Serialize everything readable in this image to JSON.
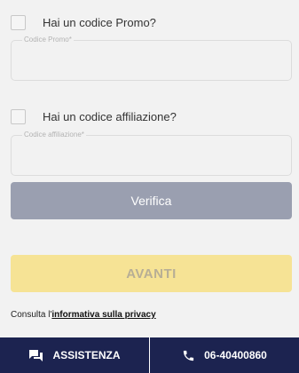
{
  "promo": {
    "checkbox_label": "Hai un codice Promo?",
    "field_label": "Codice Promo*",
    "field_value": ""
  },
  "affiliazione": {
    "checkbox_label": "Hai un codice affiliazione?",
    "field_label": "Codice affiliazione*",
    "field_value": ""
  },
  "buttons": {
    "verifica": "Verifica",
    "avanti": "AVANTI"
  },
  "privacy": {
    "prefix": "Consulta l'",
    "link": "informativa sulla privacy"
  },
  "footer": {
    "assistenza_label": "ASSISTENZA",
    "phone_label": "06-40400860"
  },
  "icons": {
    "assistenza": "chat-icon",
    "phone": "phone-icon"
  },
  "colors": {
    "verifica_bg": "#9a9fb0",
    "avanti_bg": "#f6e395",
    "footer_bg": "#1c2350"
  }
}
